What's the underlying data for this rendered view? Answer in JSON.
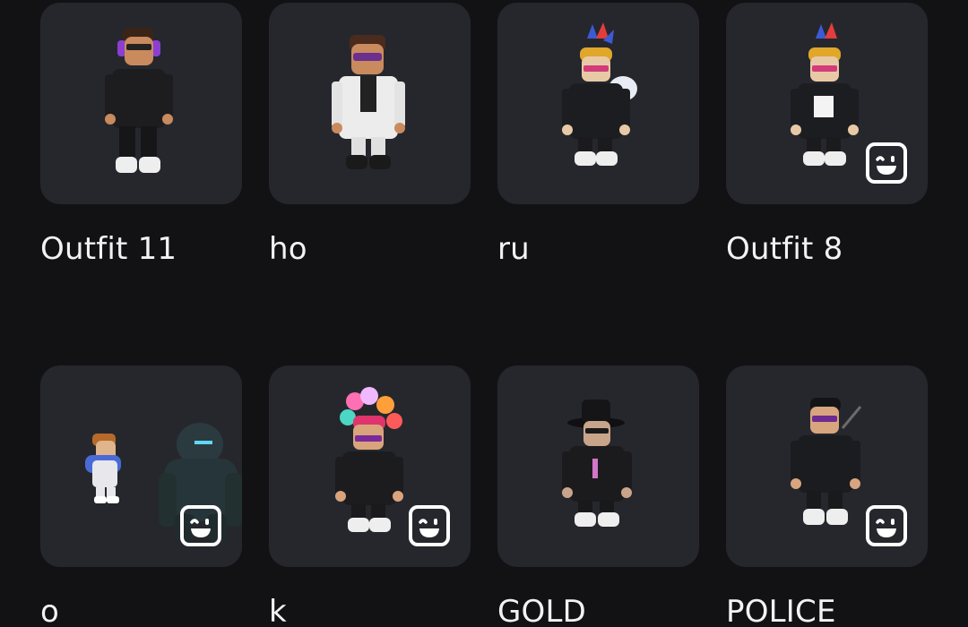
{
  "outfits": [
    {
      "name": "Outfit 11",
      "has_face_badge": false
    },
    {
      "name": "ho",
      "has_face_badge": false
    },
    {
      "name": "ru",
      "has_face_badge": false
    },
    {
      "name": "Outfit 8",
      "has_face_badge": true
    },
    {
      "name": "o",
      "has_face_badge": true
    },
    {
      "name": "k",
      "has_face_badge": true
    },
    {
      "name": "GOLD",
      "has_face_badge": false
    },
    {
      "name": "POLICE",
      "has_face_badge": true
    }
  ],
  "colors": {
    "background": "#121215",
    "card": "#26272d",
    "text": "#f2f2f2"
  },
  "icons": {
    "face_badge": "dynamic-head-smile-icon"
  }
}
